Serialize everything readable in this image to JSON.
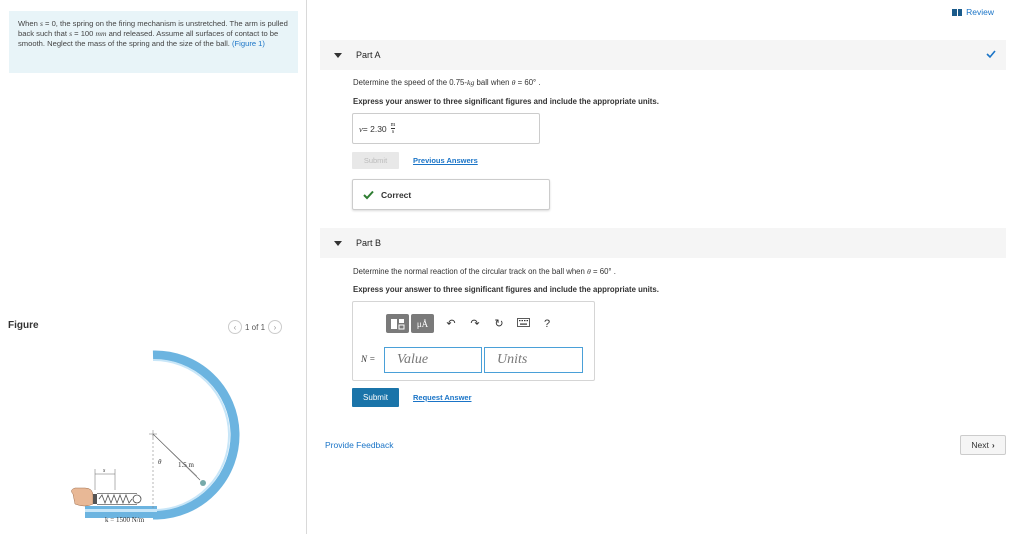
{
  "problem": {
    "text_1": "When ",
    "var_s": "s",
    "text_2": " = 0, the spring on the firing mechanism is unstretched. The arm is pulled back such that ",
    "text_3": " = 100 ",
    "unit_mm": "mm",
    "text_4": " and released. Assume all surfaces of contact to be smooth. Neglect the mass of the spring and the size of the ball. ",
    "figure_link": "(Figure 1)"
  },
  "figure": {
    "label": "Figure",
    "pager_text": "1 of 1",
    "prev_icon": "chevron-left-icon",
    "next_icon": "chevron-right-icon",
    "labels": {
      "theta": "θ",
      "radius": "1.5 m",
      "s": "s",
      "k": "k = 1500 N/m"
    }
  },
  "review": {
    "label": "Review",
    "icon": "review-bars-icon"
  },
  "part_a": {
    "title": "Part A",
    "question_1": "Determine the speed of the 0.75-",
    "question_kg": "kg",
    "question_2": " ball when ",
    "question_theta": "θ",
    "question_3": " = 60° .",
    "instruction": "Express your answer to three significant figures and include the appropriate units.",
    "answer_var": "v",
    "answer_eq": " =  2.30",
    "unit_num": "m",
    "unit_den": "s",
    "submit_label": "Submit",
    "prev_answers_label": "Previous Answers",
    "correct_label": "Correct",
    "status_icon": "check-icon"
  },
  "part_b": {
    "title": "Part B",
    "question_1": "Determine the normal reaction of the circular track on the ball when ",
    "question_theta": "θ",
    "question_2": " = 60° .",
    "instruction": "Express your answer to three significant figures and include the appropriate units.",
    "toolbar": {
      "templates_icon": "templates-icon",
      "units_label": "μÅ",
      "undo_icon": "undo-icon",
      "redo_icon": "redo-icon",
      "reset_icon": "reset-icon",
      "keyboard_icon": "keyboard-icon",
      "help_label": "?"
    },
    "n_label": "N =",
    "value_placeholder": "Value",
    "units_placeholder": "Units",
    "submit_label": "Submit",
    "request_answer_label": "Request Answer"
  },
  "footer": {
    "feedback_label": "Provide Feedback",
    "next_label": "Next"
  },
  "colors": {
    "accent": "#1a74c7",
    "submit_bg": "#1a74a9",
    "success": "#2e7d32",
    "problem_bg": "#e8f4f8"
  }
}
